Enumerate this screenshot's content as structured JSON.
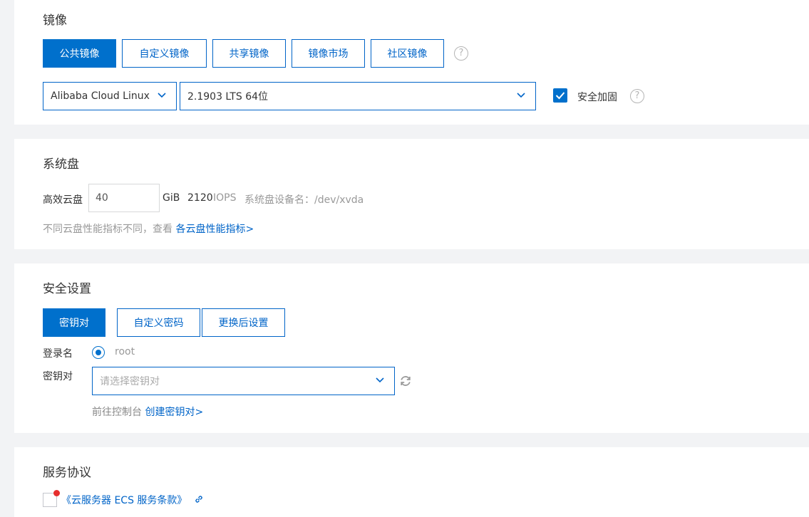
{
  "image": {
    "title": "镜像",
    "tabs": [
      "公共镜像",
      "自定义镜像",
      "共享镜像",
      "镜像市场",
      "社区镜像"
    ],
    "os_select": "Alibaba Cloud Linux",
    "version_select": "2.1903 LTS 64位",
    "hardening_label": "安全加固"
  },
  "system_disk": {
    "title": "系统盘",
    "type_label": "高效云盘",
    "size_value": "40",
    "unit": "GiB",
    "iops_number": "2120",
    "iops_label": "IOPS",
    "device_label": "系统盘设备名：/dev/xvda",
    "hint": "不同云盘性能指标不同，查看",
    "hint_link": "各云盘性能指标>"
  },
  "security": {
    "title": "安全设置",
    "tabs": [
      "密钥对",
      "自定义密码",
      "更换后设置"
    ],
    "login_label": "登录名",
    "login_value": "root",
    "keypair_label": "密钥对",
    "keypair_placeholder": "请选择密钥对",
    "console_hint": "前往控制台",
    "create_link": "创建密钥对>"
  },
  "agreement": {
    "title": "服务协议",
    "terms_link": "《云服务器 ECS 服务条款》"
  }
}
